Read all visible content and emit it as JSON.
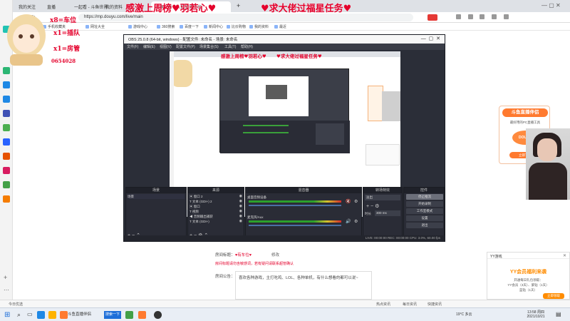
{
  "browser": {
    "tabs": [
      {
        "label": "我的关注"
      },
      {
        "label": "直播"
      },
      {
        "label": "一起看 - 斗鱼世界"
      },
      {
        "label": "我的资料"
      },
      {
        "label": "斗鱼 - 每个人的直播平台"
      }
    ],
    "new_tab_symbol": "+",
    "url": "https://mp.douyu.com/live/main",
    "bookmarks": [
      "手机收藏夹",
      "网址大全",
      "游戏中心",
      "360搜索",
      "百度一下",
      "新闻中心",
      "比价购物",
      "我的资料",
      "最近"
    ]
  },
  "overlay": {
    "banner_left": "感激上周榜♥羽若心♥",
    "banner_right": "♥求大佬过福星任务♥",
    "side_lines": [
      "x8=车位",
      "x1=插队",
      "x1=房管"
    ],
    "room_id": "0654028"
  },
  "obs": {
    "title": "OBS 25.0.8 (64-bit, windows) - 配置文件: 未命名 - 场景: 未命名",
    "menu": [
      "文件(F)",
      "编辑(E)",
      "视图(V)",
      "配置文件(P)",
      "场景集合(S)",
      "工具(T)",
      "帮助(H)"
    ],
    "preview_banner_left": "感激上周榜♥羽若心♥",
    "preview_banner_right": "♥求大佬过福星任务♥",
    "panels": {
      "scenes": {
        "title": "场景",
        "items": [
          "场景"
        ]
      },
      "sources": {
        "title": "来源",
        "items": [
          "窗口 2",
          "文本 (GDI+) 2",
          "窗口",
          "视频",
          "音频输出捕获",
          "文本 (GDI+)"
        ]
      },
      "mixer": {
        "title": "混音器",
        "channels": [
          "桌面音频设备",
          "麦克风/Aux"
        ]
      },
      "transitions": {
        "title": "转场特效",
        "type": "淡出",
        "duration_label": "时长",
        "duration": "300 ms"
      },
      "controls": {
        "title": "控件",
        "buttons": [
          "停止推流",
          "开始录制",
          "工作室模式",
          "设置",
          "退出"
        ]
      }
    },
    "status": "LIVE: 00:00:00   REC: 00:00:00   CPU: 3.0%, 60.00 fps"
  },
  "page": {
    "room_title_label": "房间标题：",
    "room_title_value": "♥有车位♥",
    "edit_label": "修改",
    "notice_red": "房间标题请勿含敏感词，若有疑问请联系超管确认",
    "announcement_label": "房间公告：",
    "announcement_text": "喜欢各种游戏，主打吃鸡、LOL、各种单机，有什么想看的都可以说~"
  },
  "ad": {
    "title": "斗鱼直播伴侣",
    "subtitle": "最好用的PC直播工具",
    "button": "立即下载",
    "brand": "DOUYU"
  },
  "yy": {
    "header": "YY游戏",
    "title": "YY会员福利来袭",
    "line1": "开通每日礼包领取：",
    "line2": "YY会员（3天）、紫钻（1天）",
    "line3": "蓝钻（1天）",
    "button": "立即领取"
  },
  "statusbar": {
    "left": "今日优选",
    "items": [
      "热点资讯",
      "每日资讯",
      "快捷资讯"
    ]
  },
  "taskbar": {
    "search_placeholder": "在这里输入你要搜索的内容",
    "tasks": [
      "斗鱼直播伴侣",
      "搜索一下"
    ],
    "weather": "19°C 多云",
    "time": "13:58 周四",
    "date": "2021/10/21"
  }
}
